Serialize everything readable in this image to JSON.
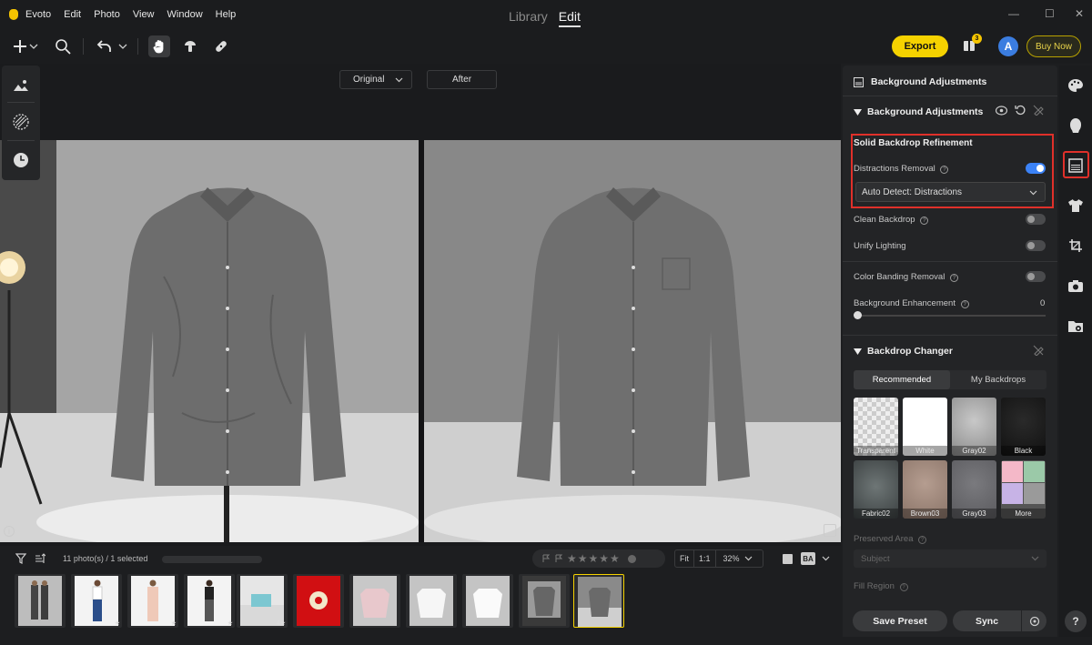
{
  "app": {
    "name": "Evoto",
    "menu": [
      "Edit",
      "Photo",
      "View",
      "Window",
      "Help"
    ]
  },
  "toolbar": {
    "mode_tabs": [
      "Library",
      "Edit"
    ],
    "active_mode": "Edit",
    "export_label": "Export",
    "notification_count": "3",
    "avatar_letter": "A",
    "buy_label": "Buy Now"
  },
  "canvas": {
    "view_select": "Original",
    "after_label": "After"
  },
  "filmstrip": {
    "count_text": "11 photo(s) / 1 selected",
    "stars": "★★★★★",
    "zoom_fit": "Fit",
    "zoom_1to1": "1:1",
    "zoom_value": "32%",
    "thumb_rating_badges": [
      "",
      "★",
      "★",
      "★",
      "4★"
    ]
  },
  "panel": {
    "title": "Background Adjustments",
    "section1_title": "Background Adjustments",
    "subsection_title": "Solid Backdrop Refinement",
    "distractions_label": "Distractions Removal",
    "distractions_on": true,
    "auto_detect_value": "Auto Detect: Distractions",
    "clean_backdrop_label": "Clean Backdrop",
    "unify_lighting_label": "Unify Lighting",
    "color_banding_label": "Color Banding Removal",
    "bg_enhancement_label": "Background Enhancement",
    "bg_enhancement_value": "0",
    "section2_title": "Backdrop Changer",
    "tabs": [
      "Recommended",
      "My Backdrops"
    ],
    "backdrops": [
      "Transparent",
      "White",
      "Gray02",
      "Black",
      "Fabric02",
      "Brown03",
      "Gray03",
      "More"
    ],
    "preserved_area_label": "Preserved Area",
    "preserved_area_value": "Subject",
    "fill_region_label": "Fill Region",
    "save_preset_label": "Save Preset",
    "sync_label": "Sync"
  },
  "colors": {
    "accent_yellow": "#f5d200",
    "toggle_on": "#3b82f6",
    "highlight_red": "#e0302a"
  }
}
